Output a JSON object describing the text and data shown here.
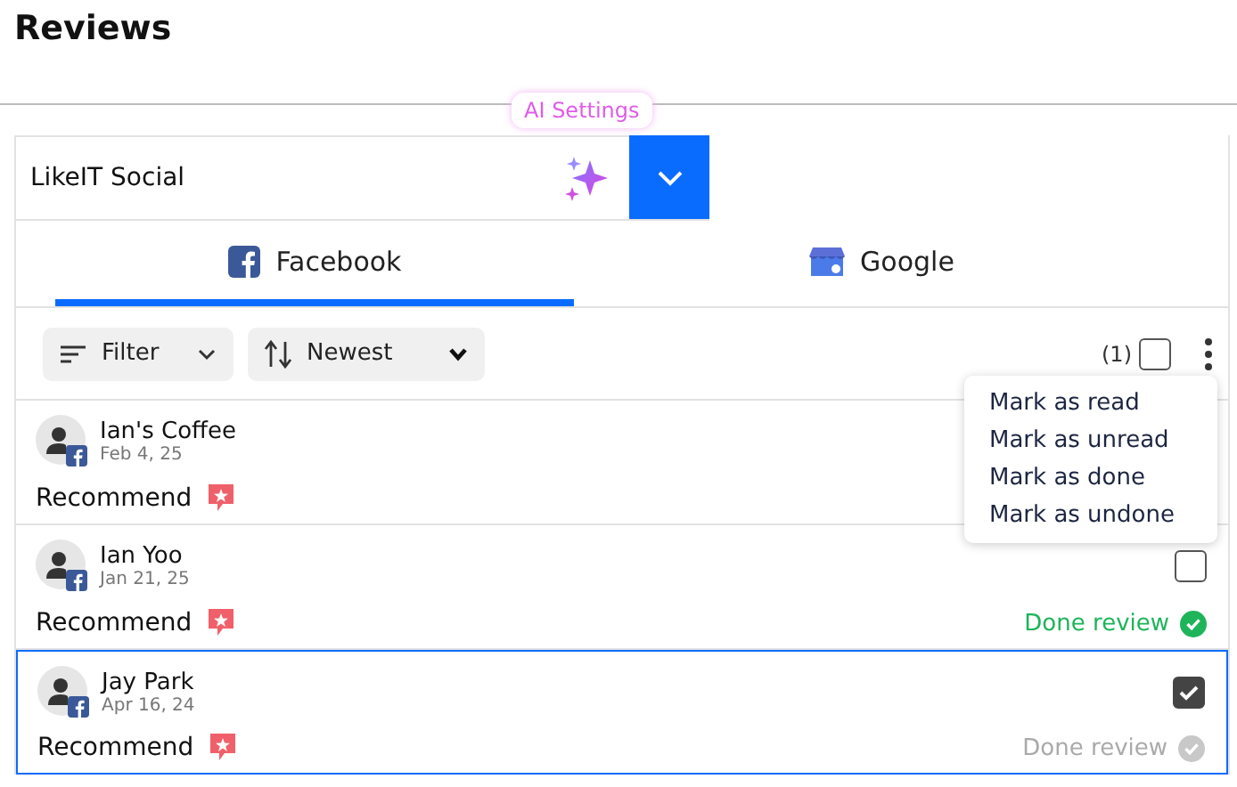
{
  "page_title": "Reviews",
  "account": {
    "value": "LikeIT Social",
    "tooltip": "AI Settings"
  },
  "tabs": [
    {
      "label": "Facebook",
      "kind": "facebook",
      "selected": true
    },
    {
      "label": "Google",
      "kind": "google",
      "selected": false
    }
  ],
  "toolbar": {
    "filter": "Filter",
    "sort": "Newest",
    "selected_count": "(1)",
    "select_all_checked": false
  },
  "reviews": [
    {
      "name": "Ian's Coffee",
      "date": "Feb 4, 25",
      "text": "Recommend",
      "selected": false
    },
    {
      "name": "Ian Yoo",
      "date": "Jan 21, 25",
      "text": "Recommend",
      "selected": false,
      "checked": false,
      "status": "Done review",
      "done": true
    },
    {
      "name": "Jay Park",
      "date": "Apr 16, 24",
      "text": "Recommend",
      "selected": true,
      "checked": true,
      "status": "Done review",
      "done": false
    }
  ],
  "menu": [
    "Mark as read",
    "Mark as unread",
    "Mark as done",
    "Mark as undone"
  ]
}
